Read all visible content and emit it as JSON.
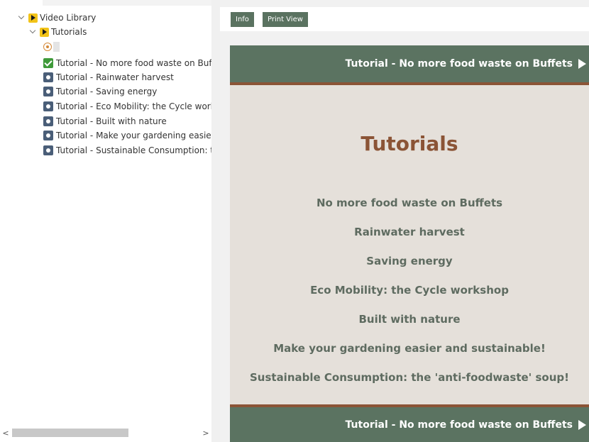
{
  "tree": {
    "root": {
      "label": "Video Library"
    },
    "folder": {
      "label": "Tutorials"
    },
    "items": [
      {
        "label": "Tutorial - No more food waste on Buff",
        "state": "checked"
      },
      {
        "label": "Tutorial - Rainwater harvest",
        "state": "normal"
      },
      {
        "label": "Tutorial - Saving energy",
        "state": "normal"
      },
      {
        "label": "Tutorial - Eco Mobility: the Cycle works",
        "state": "normal"
      },
      {
        "label": "Tutorial - Built with nature",
        "state": "normal"
      },
      {
        "label": "Tutorial - Make your gardening easier",
        "state": "normal"
      },
      {
        "label": "Tutorial - Sustainable Consumption: th",
        "state": "normal"
      }
    ],
    "scroll_left": "<",
    "scroll_right": ">"
  },
  "toolbar": {
    "info_label": "Info",
    "print_label": "Print View"
  },
  "document": {
    "top_banner": "Tutorial - No more food waste on Buffets",
    "bottom_banner": "Tutorial - No more food waste on Buffets",
    "title": "Tutorials",
    "toc": [
      "No more food waste on Buffets",
      "Rainwater harvest",
      "Saving energy",
      "Eco Mobility: the Cycle workshop",
      "Built with nature",
      "Make your gardening easier and sustainable!",
      "Sustainable Consumption: the 'anti-foodwaste' soup!"
    ]
  },
  "colors": {
    "accent_green": "#5b7361",
    "accent_brown": "#8b5436",
    "doc_background": "#e5e0da",
    "folder_yellow": "#f2c318",
    "check_green": "#3f9a3a"
  },
  "icons": {
    "tree_expand": "chevron-down-icon",
    "folder": "video-folder-icon",
    "item": "video-item-icon",
    "checked_item": "checkmark-icon",
    "locator": "locate-target-icon",
    "banner_next": "play-arrow-icon"
  }
}
